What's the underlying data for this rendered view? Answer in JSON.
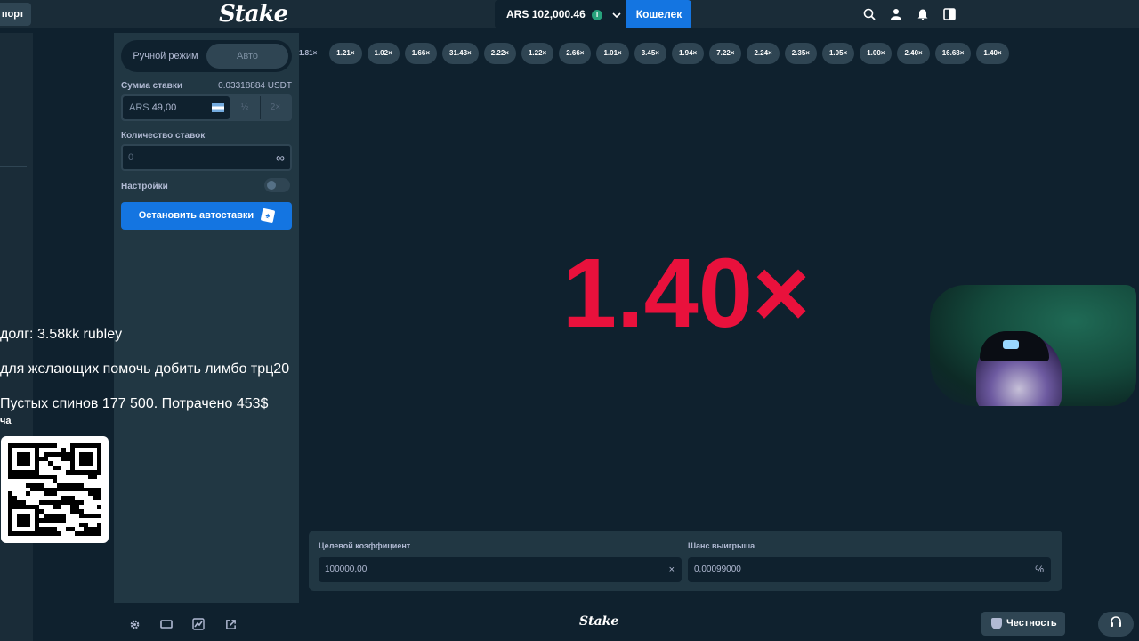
{
  "topbar": {
    "sport_label": "порт",
    "logo": "Stake",
    "balance_currency": "ARS",
    "balance_amount": "102,000.46",
    "coin_symbol": "T",
    "wallet_label": "Кошелек"
  },
  "sidebar": {
    "modes": [
      "Ручной режим",
      "Авто"
    ],
    "bet_amount_label": "Сумма ставки",
    "bet_amount_crypto": "0.03318884 USDT",
    "bet_currency": "ARS",
    "bet_value": "49,00",
    "half_label": "½",
    "double_label": "2×",
    "bet_count_label": "Количество ставок",
    "bet_count_value": "0",
    "infinity_symbol": "∞",
    "settings_label": "Настройки",
    "stop_button": "Остановить автоставки"
  },
  "history": [
    "1.81×",
    "1.21×",
    "1.02×",
    "1.66×",
    "31.43×",
    "2.22×",
    "1.22×",
    "2.66×",
    "1.01×",
    "3.45×",
    "1.94×",
    "7.22×",
    "2.24×",
    "2.35×",
    "1.05×",
    "1.00×",
    "2.40×",
    "16.68×",
    "1.40×"
  ],
  "game": {
    "multiplier": "1.40×",
    "multiplier_color": "#e9113c"
  },
  "bottom_panel": {
    "target_label": "Целевой коэффициент",
    "target_value": "100000,00",
    "target_suffix": "×",
    "chance_label": "Шанс выигрыша",
    "chance_value": "0,00099000",
    "chance_suffix": "%"
  },
  "footer": {
    "logo": "Stake",
    "fairness_label": "Честность"
  },
  "overlay": {
    "debt": "долг: 3.58kk rubley",
    "help": "для желающих помочь добить лимбо трц20",
    "spins": "Пустых спинов 177 500. Потрачено 453$",
    "small": "ча"
  },
  "colors": {
    "accent": "#1475e1",
    "background": "#0f212e",
    "panel": "#213743",
    "multiplier": "#e9113c"
  }
}
